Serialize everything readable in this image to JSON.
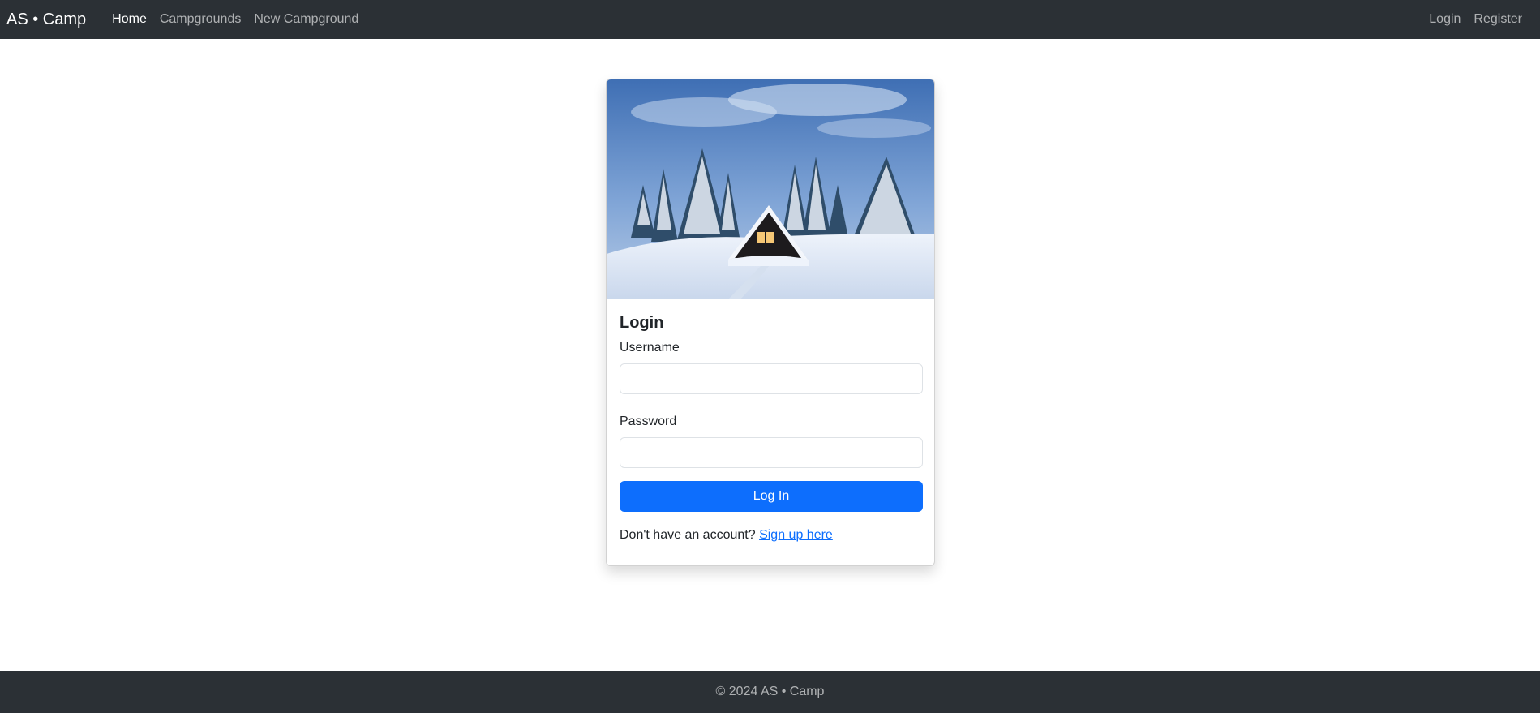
{
  "navbar": {
    "brand": "AS • Camp",
    "links": [
      {
        "label": "Home"
      },
      {
        "label": "Campgrounds"
      },
      {
        "label": "New Campground"
      }
    ],
    "right_links": [
      {
        "label": "Login"
      },
      {
        "label": "Register"
      }
    ]
  },
  "login_card": {
    "title": "Login",
    "username_label": "Username",
    "username_value": "",
    "password_label": "Password",
    "password_value": "",
    "submit_label": "Log In",
    "signup_prompt": "Don't have an account?",
    "signup_link": "Sign up here"
  },
  "footer": {
    "text": "© 2024 AS • Camp"
  },
  "colors": {
    "navbar_bg": "#2b3035",
    "primary": "#0d6efd"
  }
}
